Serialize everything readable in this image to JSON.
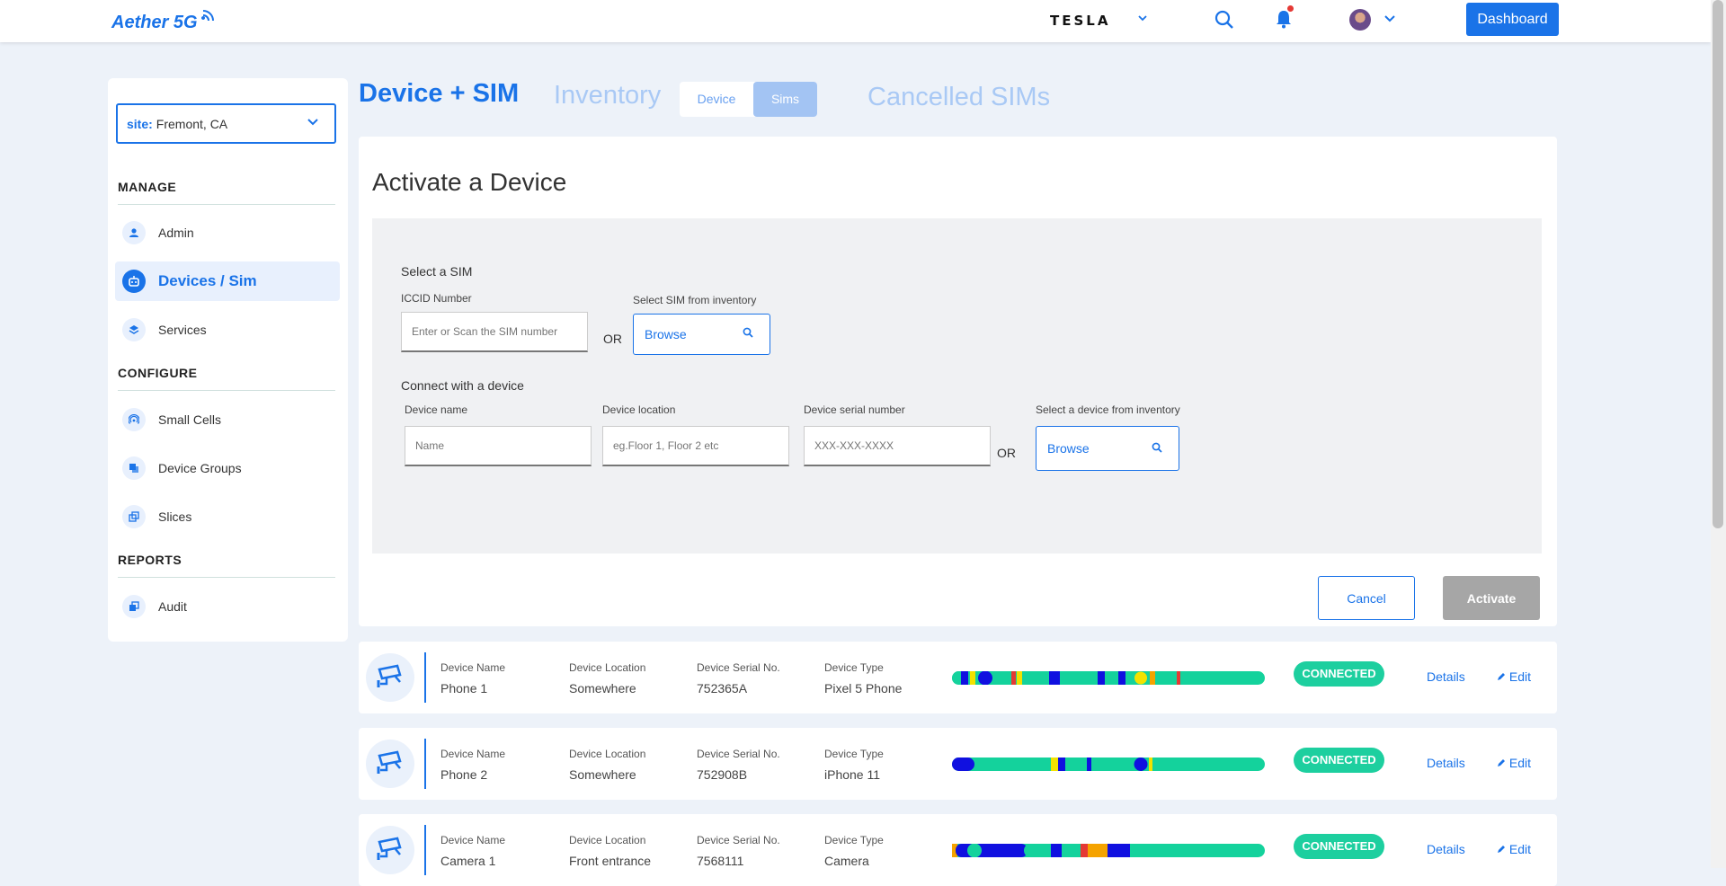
{
  "topbar": {
    "logo": "Aether 5G",
    "brand": "TESLA",
    "dashboard_label": "Dashboard"
  },
  "sidebar": {
    "site_key": "site:",
    "site_value": "Fremont, CA",
    "sections": [
      {
        "title": "MANAGE",
        "items": [
          {
            "label": "Admin",
            "icon": "user-icon"
          },
          {
            "label": "Devices / Sim",
            "icon": "robot-icon",
            "active": true
          },
          {
            "label": "Services",
            "icon": "layers-icon"
          }
        ]
      },
      {
        "title": "CONFIGURE",
        "items": [
          {
            "label": "Small Cells",
            "icon": "antenna-icon"
          },
          {
            "label": "Device Groups",
            "icon": "copy-icon"
          },
          {
            "label": "Slices",
            "icon": "slices-icon"
          }
        ]
      },
      {
        "title": "REPORTS",
        "items": [
          {
            "label": "Audit",
            "icon": "audit-icon"
          }
        ]
      }
    ]
  },
  "header": {
    "title": "Device + SIM",
    "inventory": "Inventory",
    "seg_device": "Device",
    "seg_sims": "Sims",
    "cancelled": "Cancelled SIMs"
  },
  "activate": {
    "title": "Activate a Device",
    "select_sim": "Select a SIM",
    "iccid_label": "ICCID Number",
    "iccid_placeholder": "Enter or Scan the SIM number",
    "or": "OR",
    "sim_inventory_label": "Select SIM from inventory",
    "browse": "Browse",
    "connect_device": "Connect with a device",
    "device_name_label": "Device name",
    "device_name_placeholder": "Name",
    "device_location_label": "Device location",
    "device_location_placeholder": "eg.Floor 1, Floor 2 etc",
    "device_serial_label": "Device serial number",
    "device_serial_placeholder": "XXX-XXX-XXXX",
    "device_inventory_label": "Select a device from inventory",
    "cancel": "Cancel",
    "activate": "Activate"
  },
  "devices": {
    "headers": {
      "name": "Device Name",
      "location": "Device Location",
      "serial": "Device Serial No.",
      "type": "Device Type"
    },
    "details": "Details",
    "edit": "Edit",
    "rows": [
      {
        "name": "Phone 1",
        "location": "Somewhere",
        "serial": "752365A",
        "type": "Pixel 5 Phone",
        "status": "CONNECTED"
      },
      {
        "name": "Phone 2",
        "location": "Somewhere",
        "serial": "752908B",
        "type": "iPhone 11",
        "status": "CONNECTED"
      },
      {
        "name": "Camera 1",
        "location": "Front entrance",
        "serial": "7568111",
        "type": "Camera",
        "status": "CONNECTED"
      }
    ]
  },
  "colors": {
    "accent": "#1a73e8",
    "connected": "#1dcf9f",
    "bar_green": "#14d29c",
    "bar_blue": "#1010e0",
    "bar_yellow": "#f2e200",
    "bar_orange": "#f5a300",
    "bar_red": "#e53935"
  }
}
